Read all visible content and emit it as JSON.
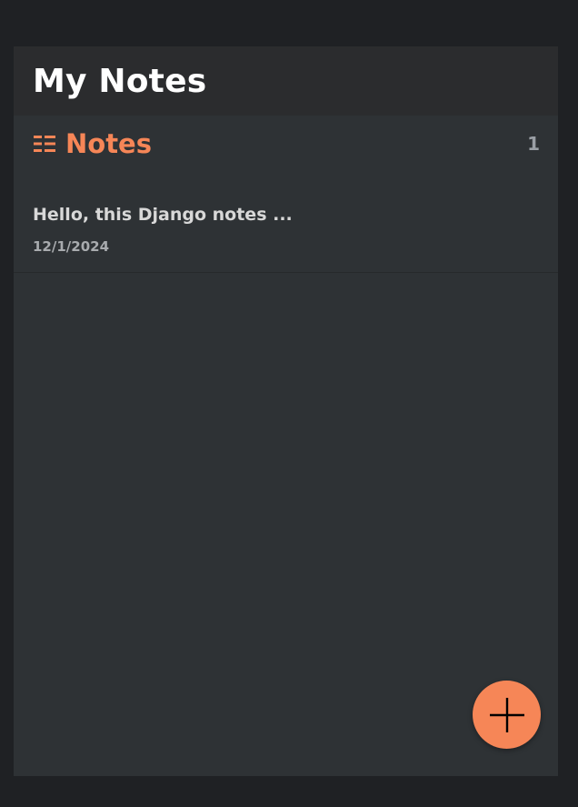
{
  "header": {
    "title": "My Notes"
  },
  "notes_section": {
    "title": "Notes",
    "count": "1",
    "icon": "list-icon"
  },
  "notes": [
    {
      "title": "Hello, this Django notes ...",
      "date": "12/1/2024"
    }
  ],
  "add_button": {
    "icon": "plus-icon"
  },
  "colors": {
    "accent": "#f68657",
    "background": "#1f2124",
    "panel": "#2e3235",
    "header": "#2b2c2e"
  }
}
